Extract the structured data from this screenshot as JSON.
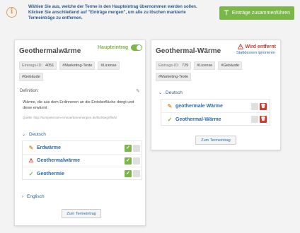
{
  "info": {
    "line1": "Wählen Sie aus, welche der Terme in den Haupteintrag übernommen werden sollen.",
    "line2": "Klicken Sie anschließend auf \"Einträge mergen\", um alle zu löschen markierte Termeinträge zu entfernen."
  },
  "merge_button": {
    "label": "Einträge zusammenführen"
  },
  "main_card": {
    "title": "Geothermalwärme",
    "main_entry_label": "Haupteintrag",
    "tags": [
      {
        "muted": "Eintrags-ID:",
        "label": "4051"
      },
      {
        "muted": "",
        "label": "#Marketing-Texte"
      },
      {
        "muted": "",
        "label": "#License"
      },
      {
        "muted": "",
        "label": "#Gebäude"
      }
    ],
    "definition_label": "Definition:",
    "definition_text": "Wärme, die aus dem Erdinneren an die Erdoberfläche dringt und diese erwärmt",
    "definition_source": "Quelle: http://kompetenzen-erneuerbareenergien.de/fachbegriffe/b/",
    "section_german": "Deutsch",
    "terms": [
      {
        "label": "Erdwärme",
        "status_icon": "pencil-icon",
        "checked": true
      },
      {
        "label": "Geothermalwärme",
        "status_icon": "warning-icon",
        "checked": true
      },
      {
        "label": "Geothermie",
        "status_icon": "check-icon",
        "checked": true
      }
    ],
    "section_english": "Englisch",
    "to_term_button": "Zum Termeintrag"
  },
  "secondary_card": {
    "title": "Geothermal-Wärme",
    "removed_label": "Wird entfernt",
    "ignore_link": "Stattdessen ignorieren",
    "tags": [
      {
        "muted": "Eintrags-ID:",
        "label": "729"
      },
      {
        "muted": "",
        "label": "#License"
      },
      {
        "muted": "",
        "label": "#Gebäude"
      },
      {
        "muted": "",
        "label": "#Marketing-Texte"
      }
    ],
    "section_german": "Deutsch",
    "terms": [
      {
        "label": "geothermale Wärme",
        "status_icon": "pencil-icon",
        "checked": false
      },
      {
        "label": "Geothermal-Wärme",
        "status_icon": "check-icon",
        "checked": false
      }
    ],
    "to_term_button": "Zum Termeintrag"
  },
  "colors": {
    "accent_green": "#7ab648",
    "link_blue": "#2c6aa8",
    "danger_red": "#c0392b",
    "warning_orange": "#e0a050"
  }
}
